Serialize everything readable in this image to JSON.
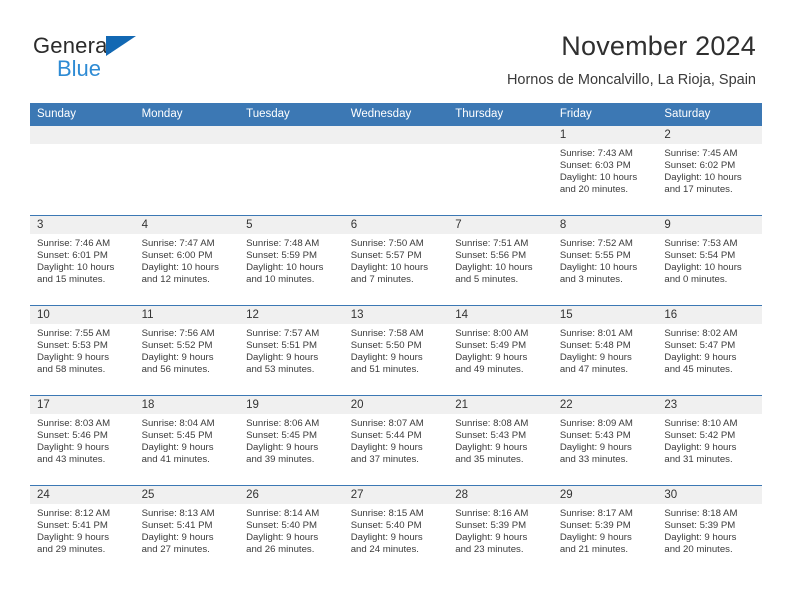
{
  "brand": {
    "name_part1": "General",
    "name_part2": "Blue",
    "triangle_icon": "blue-triangle-icon",
    "accent_color": "#1268b3",
    "accent_color_light": "#2e8bd4"
  },
  "header": {
    "title": "November 2024",
    "subtitle": "Hornos de Moncalvillo, La Rioja, Spain"
  },
  "theme": {
    "header_blue": "#3c78b4",
    "daynum_band": "#f0f0f0",
    "text": "#3b3b3b"
  },
  "calendar": {
    "weekday_headers": [
      "Sunday",
      "Monday",
      "Tuesday",
      "Wednesday",
      "Thursday",
      "Friday",
      "Saturday"
    ],
    "weeks": [
      [
        {
          "blank": true,
          "day": ""
        },
        {
          "blank": true,
          "day": ""
        },
        {
          "blank": true,
          "day": ""
        },
        {
          "blank": true,
          "day": ""
        },
        {
          "blank": true,
          "day": ""
        },
        {
          "blank": false,
          "day": "1",
          "sunrise": "Sunrise: 7:43 AM",
          "sunset": "Sunset: 6:03 PM",
          "daylight_line1": "Daylight: 10 hours",
          "daylight_line2": "and 20 minutes."
        },
        {
          "blank": false,
          "day": "2",
          "sunrise": "Sunrise: 7:45 AM",
          "sunset": "Sunset: 6:02 PM",
          "daylight_line1": "Daylight: 10 hours",
          "daylight_line2": "and 17 minutes."
        }
      ],
      [
        {
          "blank": false,
          "day": "3",
          "sunrise": "Sunrise: 7:46 AM",
          "sunset": "Sunset: 6:01 PM",
          "daylight_line1": "Daylight: 10 hours",
          "daylight_line2": "and 15 minutes."
        },
        {
          "blank": false,
          "day": "4",
          "sunrise": "Sunrise: 7:47 AM",
          "sunset": "Sunset: 6:00 PM",
          "daylight_line1": "Daylight: 10 hours",
          "daylight_line2": "and 12 minutes."
        },
        {
          "blank": false,
          "day": "5",
          "sunrise": "Sunrise: 7:48 AM",
          "sunset": "Sunset: 5:59 PM",
          "daylight_line1": "Daylight: 10 hours",
          "daylight_line2": "and 10 minutes."
        },
        {
          "blank": false,
          "day": "6",
          "sunrise": "Sunrise: 7:50 AM",
          "sunset": "Sunset: 5:57 PM",
          "daylight_line1": "Daylight: 10 hours",
          "daylight_line2": "and 7 minutes."
        },
        {
          "blank": false,
          "day": "7",
          "sunrise": "Sunrise: 7:51 AM",
          "sunset": "Sunset: 5:56 PM",
          "daylight_line1": "Daylight: 10 hours",
          "daylight_line2": "and 5 minutes."
        },
        {
          "blank": false,
          "day": "8",
          "sunrise": "Sunrise: 7:52 AM",
          "sunset": "Sunset: 5:55 PM",
          "daylight_line1": "Daylight: 10 hours",
          "daylight_line2": "and 3 minutes."
        },
        {
          "blank": false,
          "day": "9",
          "sunrise": "Sunrise: 7:53 AM",
          "sunset": "Sunset: 5:54 PM",
          "daylight_line1": "Daylight: 10 hours",
          "daylight_line2": "and 0 minutes."
        }
      ],
      [
        {
          "blank": false,
          "day": "10",
          "sunrise": "Sunrise: 7:55 AM",
          "sunset": "Sunset: 5:53 PM",
          "daylight_line1": "Daylight: 9 hours",
          "daylight_line2": "and 58 minutes."
        },
        {
          "blank": false,
          "day": "11",
          "sunrise": "Sunrise: 7:56 AM",
          "sunset": "Sunset: 5:52 PM",
          "daylight_line1": "Daylight: 9 hours",
          "daylight_line2": "and 56 minutes."
        },
        {
          "blank": false,
          "day": "12",
          "sunrise": "Sunrise: 7:57 AM",
          "sunset": "Sunset: 5:51 PM",
          "daylight_line1": "Daylight: 9 hours",
          "daylight_line2": "and 53 minutes."
        },
        {
          "blank": false,
          "day": "13",
          "sunrise": "Sunrise: 7:58 AM",
          "sunset": "Sunset: 5:50 PM",
          "daylight_line1": "Daylight: 9 hours",
          "daylight_line2": "and 51 minutes."
        },
        {
          "blank": false,
          "day": "14",
          "sunrise": "Sunrise: 8:00 AM",
          "sunset": "Sunset: 5:49 PM",
          "daylight_line1": "Daylight: 9 hours",
          "daylight_line2": "and 49 minutes."
        },
        {
          "blank": false,
          "day": "15",
          "sunrise": "Sunrise: 8:01 AM",
          "sunset": "Sunset: 5:48 PM",
          "daylight_line1": "Daylight: 9 hours",
          "daylight_line2": "and 47 minutes."
        },
        {
          "blank": false,
          "day": "16",
          "sunrise": "Sunrise: 8:02 AM",
          "sunset": "Sunset: 5:47 PM",
          "daylight_line1": "Daylight: 9 hours",
          "daylight_line2": "and 45 minutes."
        }
      ],
      [
        {
          "blank": false,
          "day": "17",
          "sunrise": "Sunrise: 8:03 AM",
          "sunset": "Sunset: 5:46 PM",
          "daylight_line1": "Daylight: 9 hours",
          "daylight_line2": "and 43 minutes."
        },
        {
          "blank": false,
          "day": "18",
          "sunrise": "Sunrise: 8:04 AM",
          "sunset": "Sunset: 5:45 PM",
          "daylight_line1": "Daylight: 9 hours",
          "daylight_line2": "and 41 minutes."
        },
        {
          "blank": false,
          "day": "19",
          "sunrise": "Sunrise: 8:06 AM",
          "sunset": "Sunset: 5:45 PM",
          "daylight_line1": "Daylight: 9 hours",
          "daylight_line2": "and 39 minutes."
        },
        {
          "blank": false,
          "day": "20",
          "sunrise": "Sunrise: 8:07 AM",
          "sunset": "Sunset: 5:44 PM",
          "daylight_line1": "Daylight: 9 hours",
          "daylight_line2": "and 37 minutes."
        },
        {
          "blank": false,
          "day": "21",
          "sunrise": "Sunrise: 8:08 AM",
          "sunset": "Sunset: 5:43 PM",
          "daylight_line1": "Daylight: 9 hours",
          "daylight_line2": "and 35 minutes."
        },
        {
          "blank": false,
          "day": "22",
          "sunrise": "Sunrise: 8:09 AM",
          "sunset": "Sunset: 5:43 PM",
          "daylight_line1": "Daylight: 9 hours",
          "daylight_line2": "and 33 minutes."
        },
        {
          "blank": false,
          "day": "23",
          "sunrise": "Sunrise: 8:10 AM",
          "sunset": "Sunset: 5:42 PM",
          "daylight_line1": "Daylight: 9 hours",
          "daylight_line2": "and 31 minutes."
        }
      ],
      [
        {
          "blank": false,
          "day": "24",
          "sunrise": "Sunrise: 8:12 AM",
          "sunset": "Sunset: 5:41 PM",
          "daylight_line1": "Daylight: 9 hours",
          "daylight_line2": "and 29 minutes."
        },
        {
          "blank": false,
          "day": "25",
          "sunrise": "Sunrise: 8:13 AM",
          "sunset": "Sunset: 5:41 PM",
          "daylight_line1": "Daylight: 9 hours",
          "daylight_line2": "and 27 minutes."
        },
        {
          "blank": false,
          "day": "26",
          "sunrise": "Sunrise: 8:14 AM",
          "sunset": "Sunset: 5:40 PM",
          "daylight_line1": "Daylight: 9 hours",
          "daylight_line2": "and 26 minutes."
        },
        {
          "blank": false,
          "day": "27",
          "sunrise": "Sunrise: 8:15 AM",
          "sunset": "Sunset: 5:40 PM",
          "daylight_line1": "Daylight: 9 hours",
          "daylight_line2": "and 24 minutes."
        },
        {
          "blank": false,
          "day": "28",
          "sunrise": "Sunrise: 8:16 AM",
          "sunset": "Sunset: 5:39 PM",
          "daylight_line1": "Daylight: 9 hours",
          "daylight_line2": "and 23 minutes."
        },
        {
          "blank": false,
          "day": "29",
          "sunrise": "Sunrise: 8:17 AM",
          "sunset": "Sunset: 5:39 PM",
          "daylight_line1": "Daylight: 9 hours",
          "daylight_line2": "and 21 minutes."
        },
        {
          "blank": false,
          "day": "30",
          "sunrise": "Sunrise: 8:18 AM",
          "sunset": "Sunset: 5:39 PM",
          "daylight_line1": "Daylight: 9 hours",
          "daylight_line2": "and 20 minutes."
        }
      ]
    ]
  }
}
